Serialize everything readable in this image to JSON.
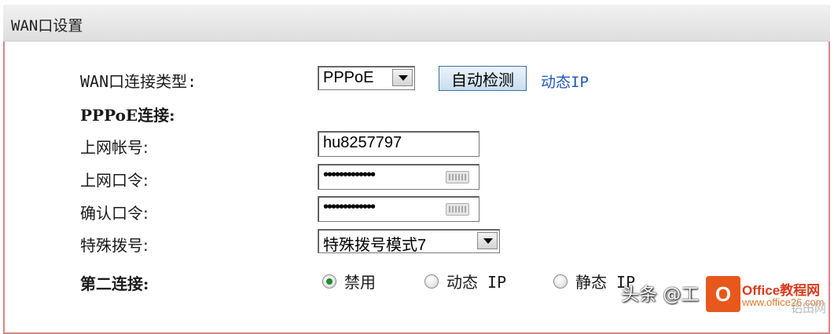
{
  "panel": {
    "title": "WAN口设置"
  },
  "wan_type": {
    "label": "WAN口连接类型:",
    "selected": "PPPoE",
    "detect_button": "自动检测",
    "detect_result": "动态IP"
  },
  "pppoe": {
    "section_label": "PPPoE连接:",
    "username_label": "上网帐号:",
    "username_value": "hu8257797",
    "password_label": "上网口令:",
    "password_mask": "•••••••••••••",
    "confirm_label": "确认口令:",
    "confirm_mask": "•••••••••••••",
    "dial_label": "特殊拨号:",
    "dial_selected": "特殊拨号模式7"
  },
  "second": {
    "label": "第二连接:",
    "options": [
      {
        "label": "禁用",
        "checked": true
      },
      {
        "label": "动态 IP",
        "checked": false
      },
      {
        "label": "静态 IP",
        "checked": false
      }
    ]
  },
  "watermark": {
    "text": "头条 @工",
    "logo_letter": "O",
    "brand": "Office教程网",
    "brand_url": "www.office26.com",
    "site": "铝田网"
  }
}
